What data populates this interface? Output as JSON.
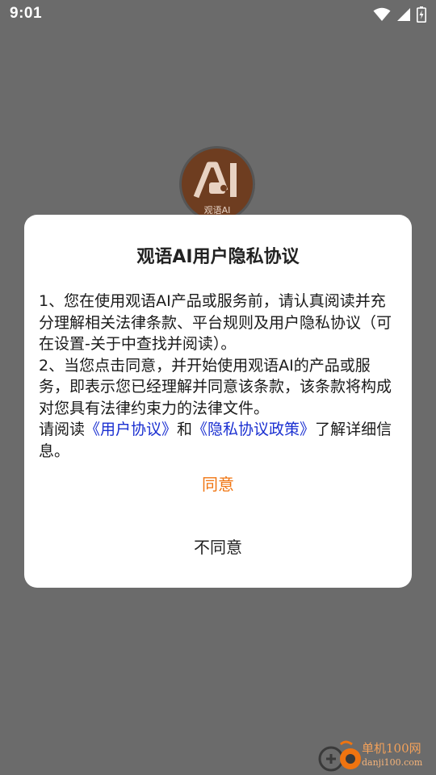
{
  "status_bar": {
    "time": "9:01",
    "icons": [
      "wifi-icon",
      "signal-icon",
      "battery-charging-icon"
    ]
  },
  "app_logo": {
    "text": "观语AI"
  },
  "dialog": {
    "title": "观语AI用户隐私协议",
    "paragraph1": "1、您在使用观语AI产品或服务前，请认真阅读并充分理解相关法律条款、平台规则及用户隐私协议（可在设置-关于中查找并阅读）。",
    "paragraph2": "2、当您点击同意，并开始使用观语AI的产品或服务，即表示您已经理解并同意该条款，该条款将构成对您具有法律约束力的法律文件。",
    "paragraph3_prefix": "请阅读",
    "user_agreement_link": "《用户协议》",
    "paragraph3_and": "和",
    "privacy_policy_link": "《隐私协议政策》",
    "paragraph3_suffix": "了解详细信息。",
    "agree_label": "同意",
    "disagree_label": "不同意",
    "colors": {
      "agree": "#f07410",
      "link": "#1a2fd1",
      "overlay": "#6b6b6b"
    }
  },
  "watermark": {
    "brand": "单机100网",
    "domain": "danji100.com"
  }
}
